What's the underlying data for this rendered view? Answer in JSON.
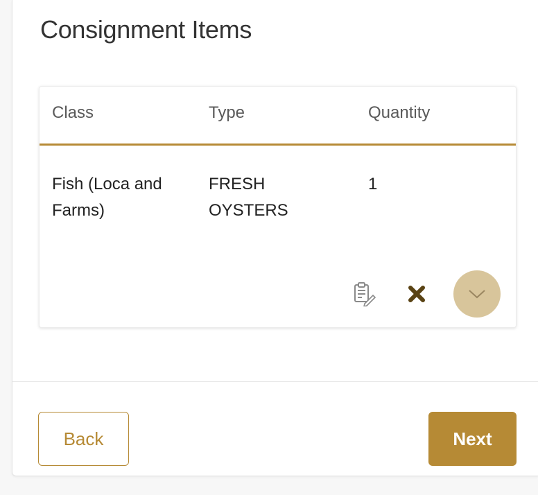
{
  "section": {
    "title": "Consignment Items"
  },
  "table": {
    "headers": {
      "class": "Class",
      "type": "Type",
      "quantity": "Quantity"
    },
    "rows": [
      {
        "class": "Fish (Loca and Farms)",
        "type": "FRESH OYSTERS",
        "quantity": "1"
      }
    ],
    "row_actions": {
      "edit_icon": "clipboard-edit-icon",
      "delete_icon": "close-x-icon",
      "expand_icon": "chevron-down-icon"
    }
  },
  "footer": {
    "back_label": "Back",
    "next_label": "Next"
  },
  "colors": {
    "accent": "#b68a35",
    "accent_light": "#d8c59b",
    "delete_icon": "#5a4314",
    "text": "#222222"
  }
}
